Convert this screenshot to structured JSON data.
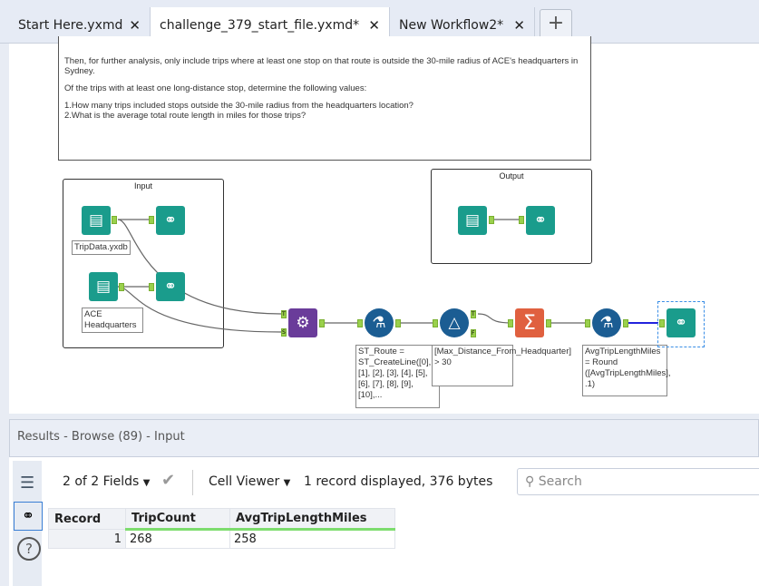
{
  "tabs": [
    {
      "label": "Start Here.yxmd",
      "active": false
    },
    {
      "label": "challenge_379_start_file.yxmd*",
      "active": true
    },
    {
      "label": "New Workflow2*",
      "active": false
    }
  ],
  "close_glyph": "✕",
  "add_tab_glyph": "+",
  "comment": {
    "p1": "Then, for further analysis, only include trips where at least one stop on that route is outside the 30-mile radius of ACE's headquarters in Sydney.",
    "p2": "Of the trips with at least one long-distance stop, determine the following values:",
    "q1": "1.How many trips included stops outside the 30-mile radius from the headquarters location?",
    "q2": "2.What is the average total route length in miles for those trips?"
  },
  "containers": {
    "input": "Input",
    "output": "Output"
  },
  "tools": {
    "input1_label": "TripData.yxdb",
    "input2_label": "ACE Headquarters",
    "formula1_label": "ST_Route = ST_CreateLine([0], [1], [2], [3], [4], [5], [6], [7], [8], [9], [10],...",
    "filter_label": "[Max_Distance_From_Headquarter] > 30",
    "formula2_label": "AvgTripLengthMiles = Round ([AvgTripLengthMiles], .1)",
    "anchor_t": "T",
    "anchor_f": "F",
    "anchor_s": "S",
    "summarize_glyph": "Σ"
  },
  "results": {
    "title": "Results - Browse (89) - Input",
    "fields": "2 of 2 Fields",
    "viewer": "Cell Viewer",
    "status": "1 record displayed, 376 bytes",
    "search_placeholder": "Search",
    "columns": [
      "Record",
      "TripCount",
      "AvgTripLengthMiles"
    ],
    "rows": [
      [
        "1",
        "268",
        "258"
      ]
    ]
  },
  "colors": {
    "teal": "#1a9c8c",
    "purple": "#6a3c9a",
    "blue": "#1b5d93",
    "orange": "#e0603f",
    "anchor": "#9ad04c"
  }
}
